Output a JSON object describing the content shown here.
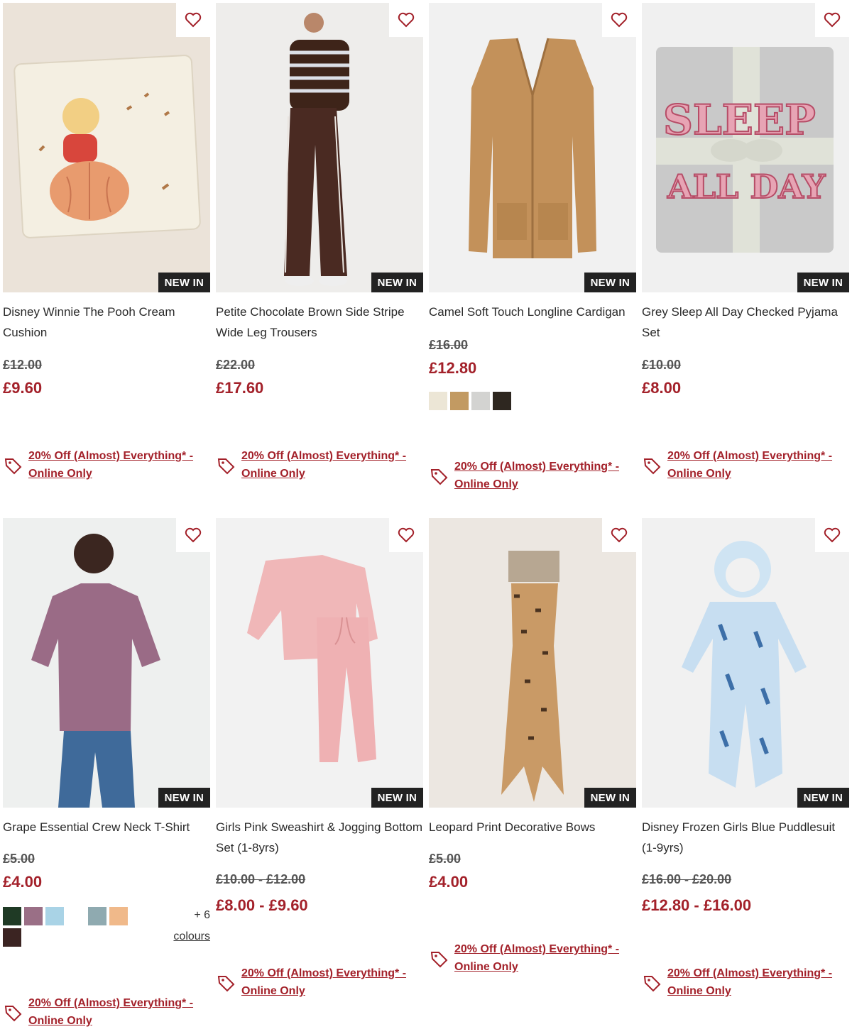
{
  "products": [
    {
      "title": "Disney Winnie The Pooh Cream Cushion",
      "badge": "NEW IN",
      "was_price": "£12.00",
      "now_price": "£9.60",
      "promo_line1": "20% Off (Almost) Everything* -",
      "promo_line2": "Online Only"
    },
    {
      "title": "Petite Chocolate Brown Side Stripe Wide Leg Trousers",
      "badge": "NEW IN",
      "was_price": "£22.00",
      "now_price": "£17.60",
      "promo_line1": "20% Off (Almost) Everything* -",
      "promo_line2": "Online Only"
    },
    {
      "title": "Camel Soft Touch Longline Cardigan",
      "badge": "NEW IN",
      "was_price": "£16.00",
      "now_price": "£12.80",
      "swatches": [
        "#ece6d6",
        "#c29a62",
        "#d3d3d1",
        "#2e2720"
      ],
      "promo_line1": "20% Off (Almost) Everything* -",
      "promo_line2": "Online Only"
    },
    {
      "title": "Grey Sleep All Day Checked Pyjama Set",
      "badge": "NEW IN",
      "was_price": "£10.00",
      "now_price": "£8.00",
      "promo_line1": "20% Off (Almost) Everything* -",
      "promo_line2": "Online Only"
    },
    {
      "title": "Grape Essential Crew Neck T-Shirt",
      "badge": "NEW IN",
      "was_price": "£5.00",
      "now_price": "£4.00",
      "swatches": [
        "#1f3a25",
        "#9a6f86",
        "#a9d3e6",
        "#ffffff",
        "#8faab0",
        "#f0b98a",
        "#3b2422"
      ],
      "more_count": "+ 6",
      "more_label": "colours",
      "promo_line1": "20% Off (Almost) Everything* -",
      "promo_line2": "Online Only"
    },
    {
      "title": "Girls Pink Sweashirt & Jogging Bottom Set (1-8yrs)",
      "badge": "NEW IN",
      "was_price": "£10.00 - £12.00",
      "now_price": "£8.00 - £9.60",
      "promo_line1": "20% Off (Almost) Everything* -",
      "promo_line2": "Online Only"
    },
    {
      "title": "Leopard Print Decorative Bows",
      "badge": "NEW IN",
      "was_price": "£5.00",
      "now_price": "£4.00",
      "promo_line1": "20% Off (Almost) Everything* -",
      "promo_line2": "Online Only"
    },
    {
      "title": "Disney Frozen Girls Blue Puddlesuit (1-9yrs)",
      "badge": "NEW IN",
      "was_price": "£16.00 - £20.00",
      "now_price": "£12.80 - £16.00",
      "promo_line1": "20% Off (Almost) Everything* -",
      "promo_line2": "Online Only"
    }
  ],
  "pyjama_print": {
    "line1": "SLEEP",
    "line2": "ALL DAY"
  },
  "colors": {
    "accent": "#a3212a",
    "badge_bg": "#222222"
  }
}
